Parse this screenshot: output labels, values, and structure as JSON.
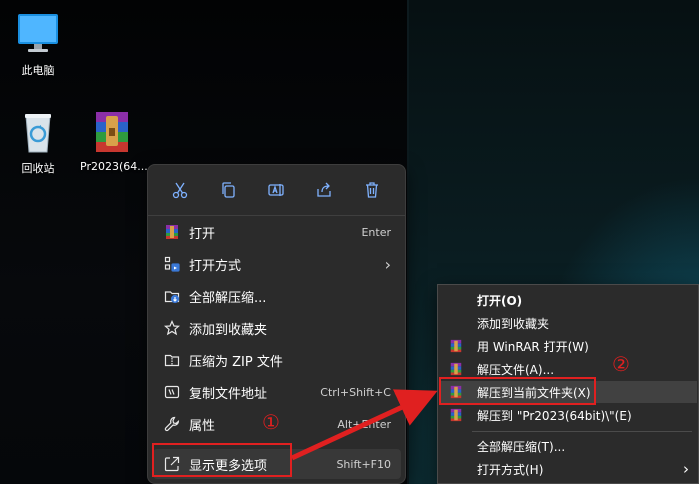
{
  "desktop": {
    "icons": [
      {
        "label": "此电脑",
        "icon": "monitor-icon"
      },
      {
        "label": "回收站",
        "icon": "recycle-bin-icon"
      },
      {
        "label": "Pr2023(64...",
        "icon": "winrar-archive-icon"
      }
    ]
  },
  "win11_menu": {
    "toolbar": [
      "cut-icon",
      "copy-icon",
      "rename-icon",
      "share-icon",
      "delete-icon"
    ],
    "items": [
      {
        "label": "打开",
        "shortcut": "Enter",
        "icon": "winrar-icon"
      },
      {
        "label": "打开方式",
        "shortcut": "",
        "icon": "open-with-icon",
        "submenu": "›"
      },
      {
        "label": "全部解压缩...",
        "shortcut": "",
        "icon": "extract-all-icon"
      },
      {
        "label": "添加到收藏夹",
        "shortcut": "",
        "icon": "star-icon"
      },
      {
        "label": "压缩为 ZIP 文件",
        "shortcut": "",
        "icon": "zip-icon"
      },
      {
        "label": "复制文件地址",
        "shortcut": "Ctrl+Shift+C",
        "icon": "copy-path-icon"
      },
      {
        "label": "属性",
        "shortcut": "Alt+Enter",
        "icon": "wrench-icon"
      },
      {
        "label": "显示更多选项",
        "shortcut": "Shift+F10",
        "icon": "more-options-icon"
      }
    ]
  },
  "classic_menu": {
    "items": [
      {
        "label": "打开(O)",
        "icon": ""
      },
      {
        "label": "添加到收藏夹",
        "icon": ""
      },
      {
        "label": "用 WinRAR 打开(W)",
        "icon": "winrar-icon"
      },
      {
        "label": "解压文件(A)...",
        "icon": "winrar-icon"
      },
      {
        "label": "解压到当前文件夹(X)",
        "icon": "winrar-icon"
      },
      {
        "label": "解压到 \"Pr2023(64bit)\\\"(E)",
        "icon": "winrar-icon"
      },
      {
        "label": "全部解压缩(T)...",
        "icon": ""
      },
      {
        "label": "打开方式(H)",
        "icon": "",
        "submenu": "›"
      }
    ]
  },
  "annotations": {
    "step1": "①",
    "step2": "②"
  },
  "colors": {
    "annotation": "#e02020",
    "menu_bg": "#2b2b2b",
    "highlight": "#383838"
  }
}
